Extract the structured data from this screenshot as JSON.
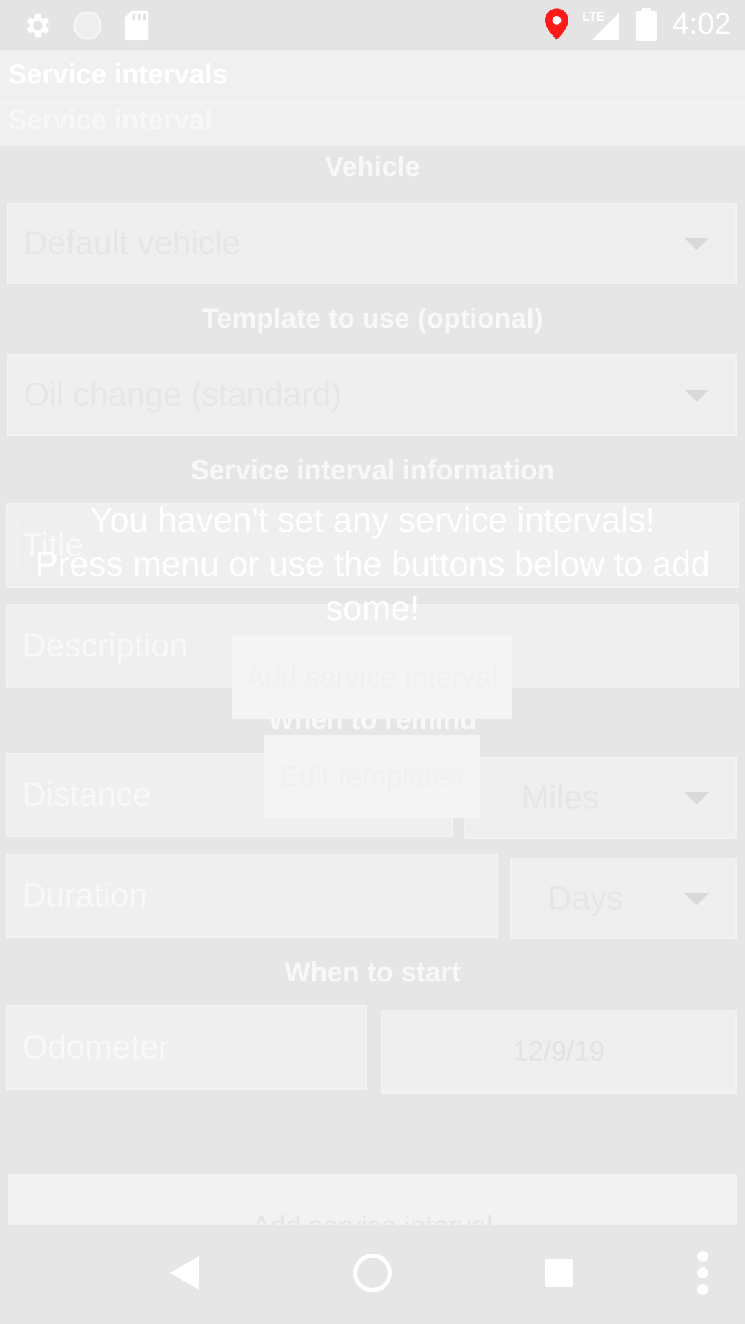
{
  "status_bar": {
    "time": "4:02",
    "icons": [
      "gear-icon",
      "circle-icon",
      "sd-card-icon",
      "location-pin-icon",
      "lte-signal-icon",
      "battery-icon"
    ],
    "network_label": "LTE",
    "accent_location": "#ff1a1a"
  },
  "app_bar": {
    "title": "Service intervals",
    "subtitle": "Service interval"
  },
  "form": {
    "vehicle_label": "Vehicle",
    "vehicle_value": "Default vehicle",
    "template_label": "Template to use (optional)",
    "template_value": "Oil change (standard)",
    "info_label": "Service interval information",
    "title_placeholder": "Title",
    "description_placeholder": "Description",
    "remind_label": "When to remind",
    "distance_placeholder": "Distance",
    "distance_unit": "Miles",
    "duration_placeholder": "Duration",
    "duration_unit": "Days",
    "start_label": "When to start",
    "odometer_placeholder": "Odometer",
    "start_date": "12/9/19",
    "submit_label": "Add service interval"
  },
  "empty_state": {
    "line1": "You haven't set any service intervals!",
    "line2": "Press menu or use the buttons below to add",
    "line3": "some!",
    "add_button": "Add service interval",
    "edit_button": "Edit templates"
  },
  "nav_bar": {
    "icons": [
      "back-icon",
      "home-icon",
      "recents-icon",
      "overflow-menu-icon"
    ]
  }
}
